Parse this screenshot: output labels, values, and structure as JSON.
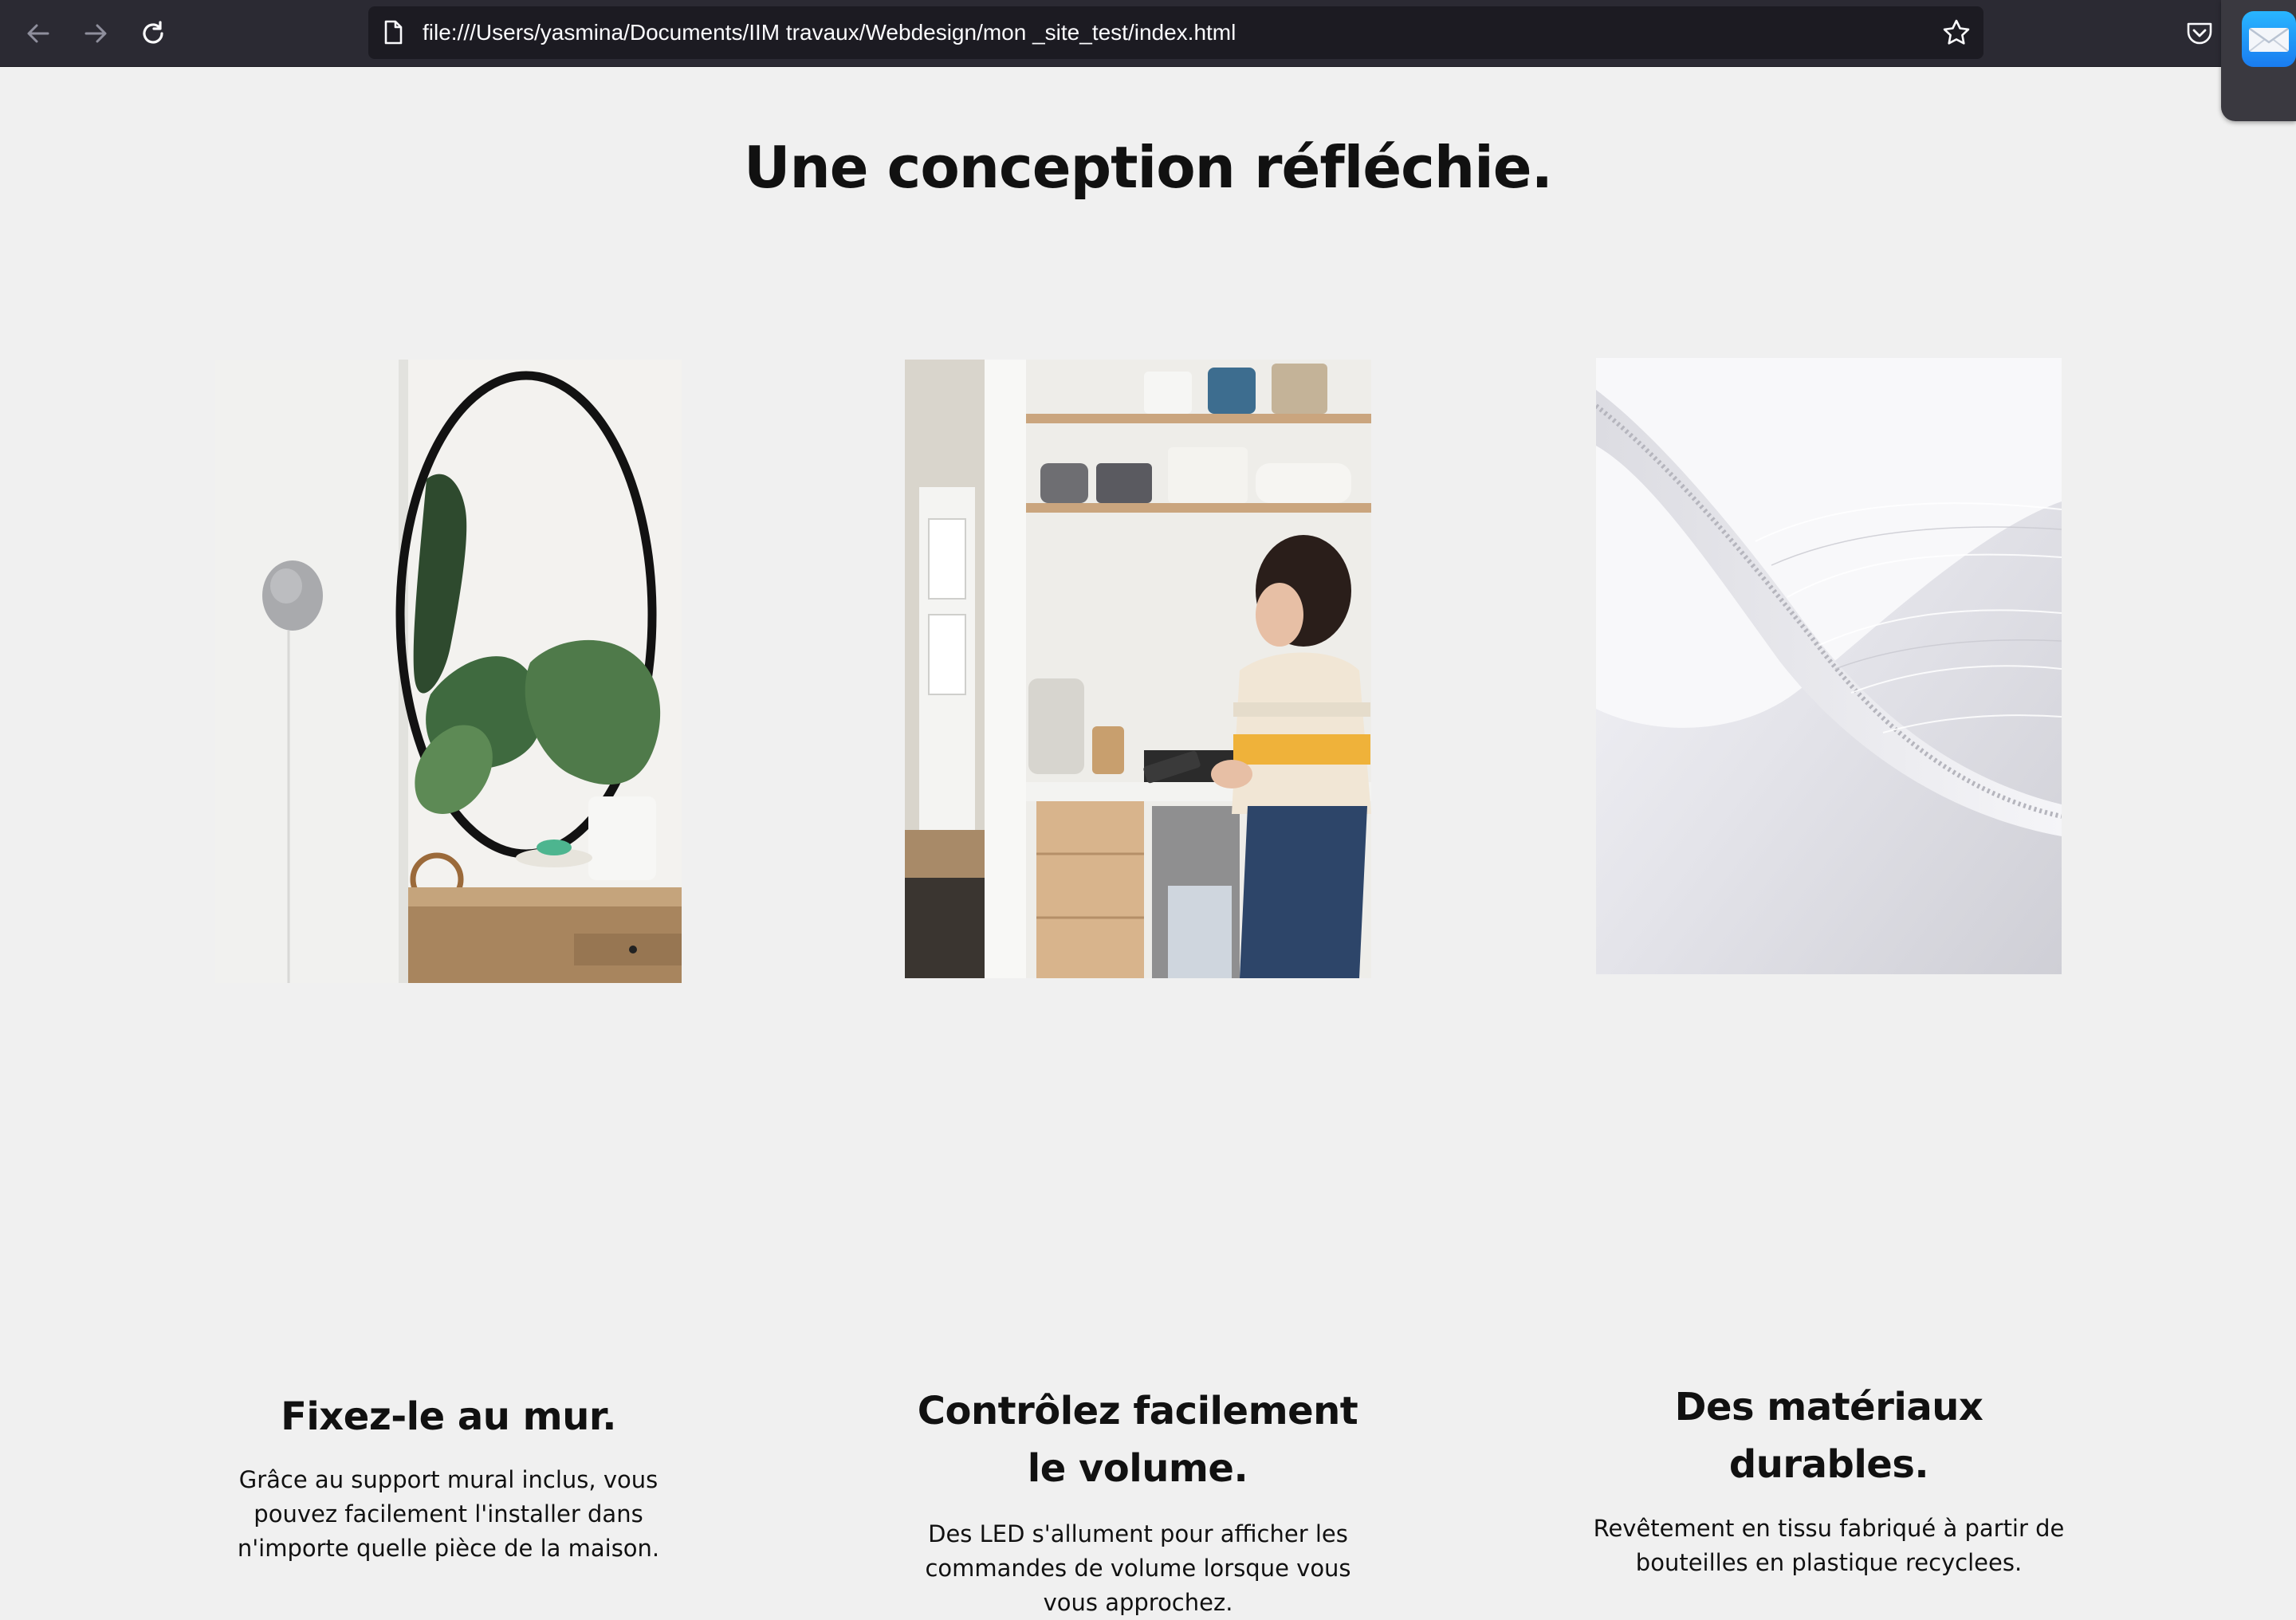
{
  "browser": {
    "url": "file:///Users/yasmina/Documents/IIM travaux/Webdesign/mon _site_test/index.html",
    "icons": [
      "back-arrow-icon",
      "forward-arrow-icon",
      "reload-icon",
      "page-icon",
      "bookmark-star-icon",
      "pocket-icon",
      "mail-icon"
    ]
  },
  "page": {
    "heading": "Une conception réfléchie.",
    "features": [
      {
        "title": "Fixez-le au mur.",
        "description": "Grâce au support mural inclus, vous pouvez facilement l'installer dans n'importe quelle pièce de la maison."
      },
      {
        "title": "Contrôlez facilement le volume.",
        "description": "Des LED s'allument pour afficher les commandes de volume lorsque vous vous approchez."
      },
      {
        "title": "Des matériaux durables.",
        "description": "Revêtement en tissu fabriqué à partir de bouteilles en plastique recyclees."
      }
    ]
  },
  "colors": {
    "toolbar": "#2b2a33",
    "urlbar": "#1c1b22",
    "page_background": "#f0f0f0",
    "text": "#111111"
  }
}
